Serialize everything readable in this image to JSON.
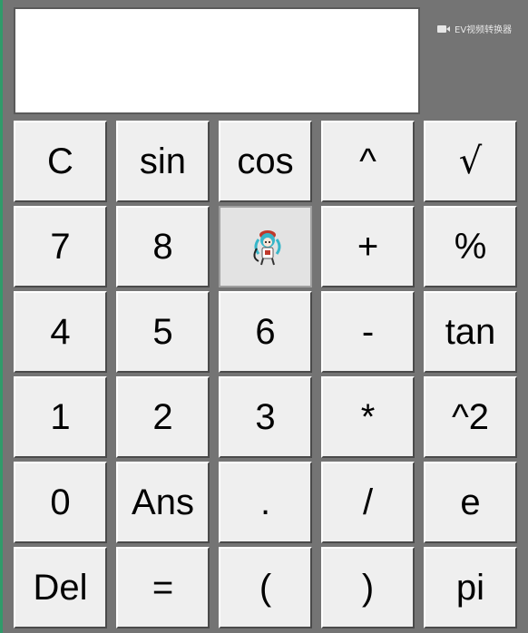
{
  "display": {
    "value": ""
  },
  "watermark": {
    "text": "EV视频转换器",
    "icon": "video-camera-icon"
  },
  "keys": [
    {
      "label": "C",
      "name": "clear-button"
    },
    {
      "label": "sin",
      "name": "sin-button"
    },
    {
      "label": "cos",
      "name": "cos-button"
    },
    {
      "label": "^",
      "name": "power-button"
    },
    {
      "label": "√",
      "name": "sqrt-button"
    },
    {
      "label": "7",
      "name": "digit-7-button"
    },
    {
      "label": "8",
      "name": "digit-8-button"
    },
    {
      "label": "",
      "name": "digit-9-button",
      "hovered": true
    },
    {
      "label": "+",
      "name": "add-button"
    },
    {
      "label": "%",
      "name": "percent-button"
    },
    {
      "label": "4",
      "name": "digit-4-button"
    },
    {
      "label": "5",
      "name": "digit-5-button"
    },
    {
      "label": "6",
      "name": "digit-6-button"
    },
    {
      "label": "-",
      "name": "subtract-button"
    },
    {
      "label": "tan",
      "name": "tan-button"
    },
    {
      "label": "1",
      "name": "digit-1-button"
    },
    {
      "label": "2",
      "name": "digit-2-button"
    },
    {
      "label": "3",
      "name": "digit-3-button"
    },
    {
      "label": "*",
      "name": "multiply-button"
    },
    {
      "label": "^2",
      "name": "square-button"
    },
    {
      "label": "0",
      "name": "digit-0-button"
    },
    {
      "label": "Ans",
      "name": "ans-button"
    },
    {
      "label": ".",
      "name": "decimal-button"
    },
    {
      "label": "/",
      "name": "divide-button"
    },
    {
      "label": "e",
      "name": "e-constant-button"
    },
    {
      "label": "Del",
      "name": "delete-button"
    },
    {
      "label": "=",
      "name": "equals-button"
    },
    {
      "label": "(",
      "name": "open-paren-button"
    },
    {
      "label": ")",
      "name": "close-paren-button"
    },
    {
      "label": "pi",
      "name": "pi-button"
    }
  ]
}
